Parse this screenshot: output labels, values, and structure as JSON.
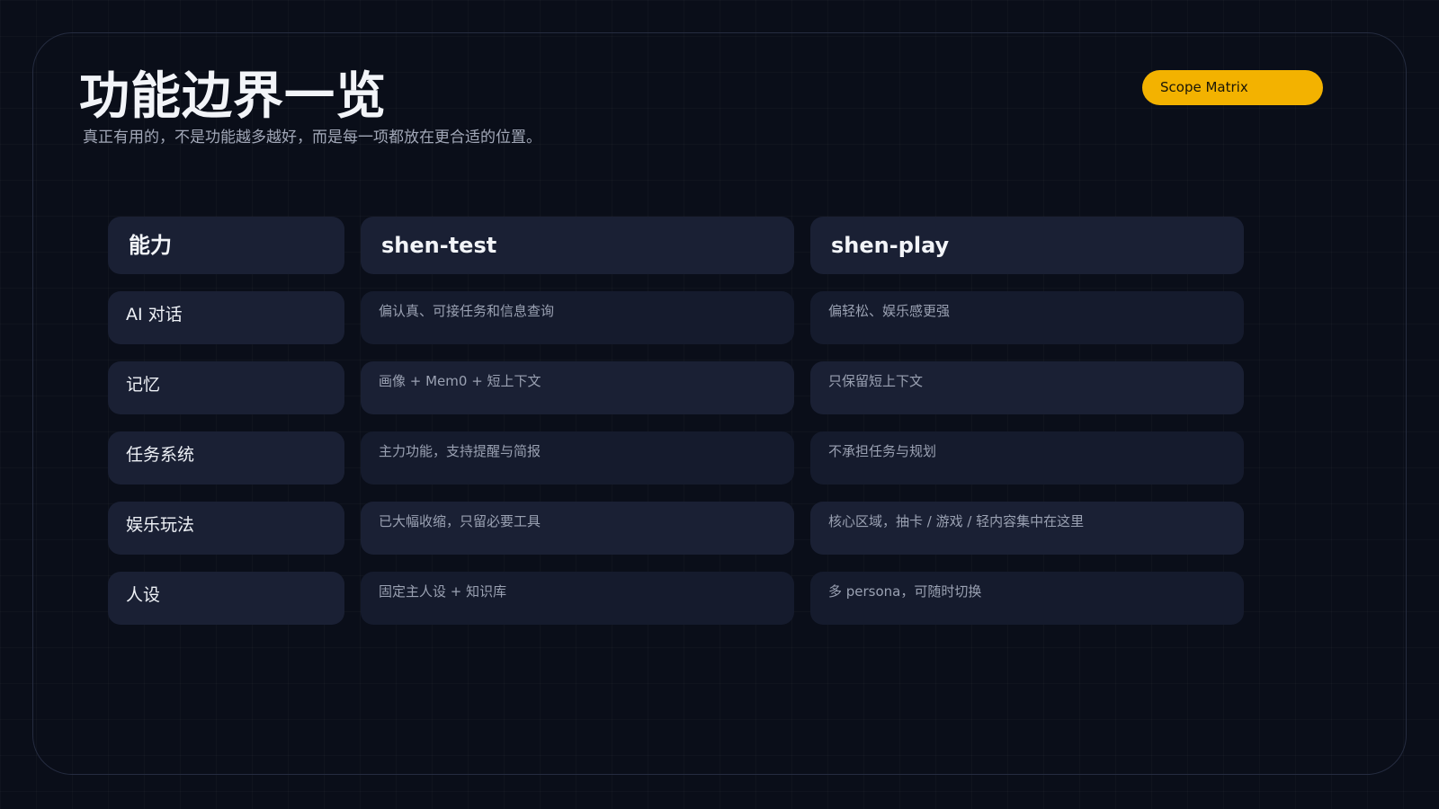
{
  "title": "功能边界一览",
  "subtitle": "真正有用的，不是功能越多越好，而是每一项都放在更合适的位置。",
  "badge": "Scope Matrix",
  "table": {
    "headers": [
      "能力",
      "shen-test",
      "shen-play"
    ],
    "rows": [
      {
        "capability": "AI 对话",
        "shen_test": "偏认真、可接任务和信息查询",
        "shen_play": "偏轻松、娱乐感更强"
      },
      {
        "capability": "记忆",
        "shen_test": "画像 + Mem0 + 短上下文",
        "shen_play": "只保留短上下文"
      },
      {
        "capability": "任务系统",
        "shen_test": "主力功能，支持提醒与简报",
        "shen_play": "不承担任务与规划"
      },
      {
        "capability": "娱乐玩法",
        "shen_test": "已大幅收缩，只留必要工具",
        "shen_play": "核心区域，抽卡 / 游戏 / 轻内容集中在这里"
      },
      {
        "capability": "人设",
        "shen_test": "固定主人设 + 知识库",
        "shen_play": "多 persona，可随时切换"
      }
    ]
  },
  "colors": {
    "background": "#0a0e19",
    "accent": "#f3b200",
    "cell_light": "#1a2034",
    "cell_dark": "#151b2d"
  }
}
